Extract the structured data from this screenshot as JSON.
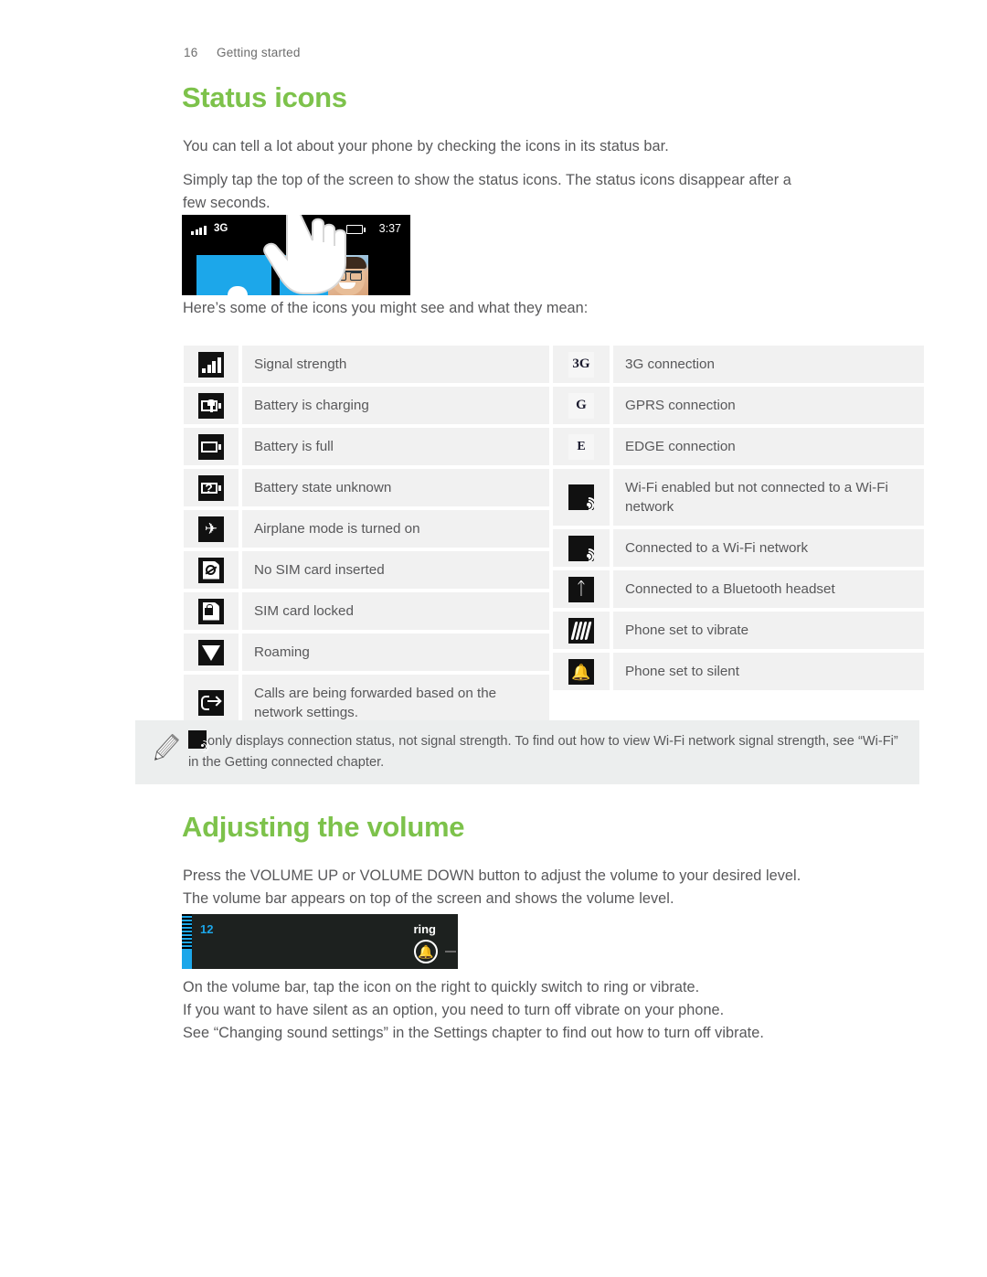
{
  "header": {
    "page_number": "16",
    "chapter": "Getting started"
  },
  "sections": {
    "status_icons": {
      "heading": "Status icons",
      "intro": "You can tell a lot about your phone by checking the icons in its status bar.",
      "para2_line1": "Simply tap the top of the screen to show the status icons. The status icons disappear after a",
      "para2_line2": "few seconds.",
      "para3": "Here’s some of the icons you might see and what they mean:"
    },
    "volume": {
      "heading": "Adjusting the volume",
      "para_line1": "Press the VOLUME UP or VOLUME DOWN button to adjust the volume to your desired level.",
      "para_line2": "The volume bar appears on top of the screen and shows the volume level.",
      "after_line1": "On the volume bar, tap the icon on the right to quickly switch to ring or vibrate.",
      "after_line2": "If you want to have silent as an option, you need to turn off vibrate on your phone.",
      "after_line3": "See “Changing sound settings” in the Settings chapter to find out how to turn off vibrate."
    }
  },
  "phone_screenshot": {
    "network_label": "3G",
    "clock": "3:37",
    "signal_icon": "signal-bars-icon",
    "battery_icon": "battery-icon",
    "arrow_icon": "arrow-right-circle-icon",
    "hand_icon": "pointing-hand-icon"
  },
  "icon_table": {
    "left_column": [
      {
        "icon": "signal-strength-icon",
        "label": "Signal strength"
      },
      {
        "icon": "battery-charging-icon",
        "label": "Battery is charging"
      },
      {
        "icon": "battery-full-icon",
        "label": "Battery is full"
      },
      {
        "icon": "battery-unknown-icon",
        "label": "Battery state unknown"
      },
      {
        "icon": "airplane-mode-icon",
        "label": "Airplane mode is turned on"
      },
      {
        "icon": "no-sim-card-icon",
        "label": "No SIM card inserted"
      },
      {
        "icon": "sim-card-locked-icon",
        "label": "SIM card locked"
      },
      {
        "icon": "roaming-icon",
        "label": "Roaming"
      },
      {
        "icon": "call-forwarding-icon",
        "label": "Calls are being forwarded based on the network settings."
      }
    ],
    "right_column": [
      {
        "icon": "3g-connection-icon",
        "glyph": "3G",
        "label": "3G connection"
      },
      {
        "icon": "gprs-connection-icon",
        "glyph": "G",
        "label": "GPRS connection"
      },
      {
        "icon": "edge-connection-icon",
        "glyph": "E",
        "label": "EDGE connection"
      },
      {
        "icon": "wifi-enabled-icon",
        "label": "Wi-Fi enabled but not connected to a Wi-Fi network"
      },
      {
        "icon": "wifi-connected-icon",
        "label": "Connected to a Wi-Fi network"
      },
      {
        "icon": "bluetooth-connected-icon",
        "label": "Connected to a Bluetooth headset"
      },
      {
        "icon": "vibrate-icon",
        "label": "Phone set to vibrate"
      },
      {
        "icon": "silent-icon",
        "label": "Phone set to silent"
      }
    ]
  },
  "note": {
    "pencil_icon": "pencil-icon",
    "inline_icon": "wifi-icon",
    "text_line1": "only displays connection status, not signal strength. To find out how to view Wi-Fi network signal",
    "text_line2": "strength, see “Wi-Fi” in the Getting connected chapter."
  },
  "volume_screenshot": {
    "level": "12",
    "mode": "ring",
    "bell_icon": "bell-icon",
    "accent_color": "#1ca7ea"
  },
  "colors": {
    "heading_green": "#7dc24b",
    "body_text": "#58585a",
    "cell_bg": "#f1f1f1",
    "note_bg": "#eceeee"
  }
}
